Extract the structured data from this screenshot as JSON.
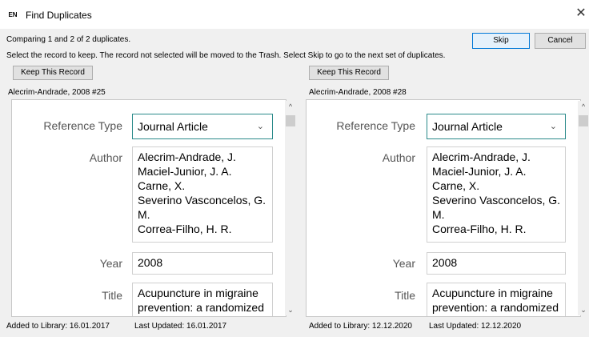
{
  "window": {
    "badge": "EN",
    "title": "Find Duplicates",
    "close_glyph": "✕"
  },
  "status": "Comparing 1 and 2 of 2 duplicates.",
  "instructions": "Select the record to keep. The record not selected will be moved to the Trash. Select Skip to go to the next set of duplicates.",
  "buttons": {
    "skip": "Skip",
    "cancel": "Cancel"
  },
  "left": {
    "keep_label": "Keep This Record",
    "record_label": "Alecrim-Andrade, 2008 #25",
    "fields": {
      "reference_type_label": "Reference Type",
      "reference_type_value": "Journal Article",
      "author_label": "Author",
      "authors": [
        "Alecrim-Andrade, J.",
        "Maciel-Junior, J. A.",
        "Carne, X.",
        "Severino Vasconcelos, G.",
        "M.",
        "Correa-Filho, H. R."
      ],
      "year_label": "Year",
      "year_value": "2008",
      "title_label": "Title",
      "title_lines": [
        "Acupuncture in migraine",
        "prevention: a randomized"
      ]
    },
    "added": "Added to Library: 16.01.2017",
    "updated": "Last Updated: 16.01.2017"
  },
  "right": {
    "keep_label": "Keep This Record",
    "record_label": "Alecrim-Andrade, 2008 #28",
    "fields": {
      "reference_type_label": "Reference Type",
      "reference_type_value": "Journal Article",
      "author_label": "Author",
      "authors": [
        "Alecrim-Andrade, J.",
        "Maciel-Junior, J. A.",
        "Carne, X.",
        "Severino Vasconcelos, G.",
        "M.",
        "Correa-Filho, H. R."
      ],
      "year_label": "Year",
      "year_value": "2008",
      "title_label": "Title",
      "title_lines": [
        "Acupuncture in migraine",
        "prevention: a randomized"
      ]
    },
    "added": "Added to Library: 12.12.2020",
    "updated": "Last Updated: 12.12.2020"
  },
  "icons": {
    "chevron_down": "⌄",
    "scroll_up": "^",
    "scroll_down": "⌄"
  }
}
